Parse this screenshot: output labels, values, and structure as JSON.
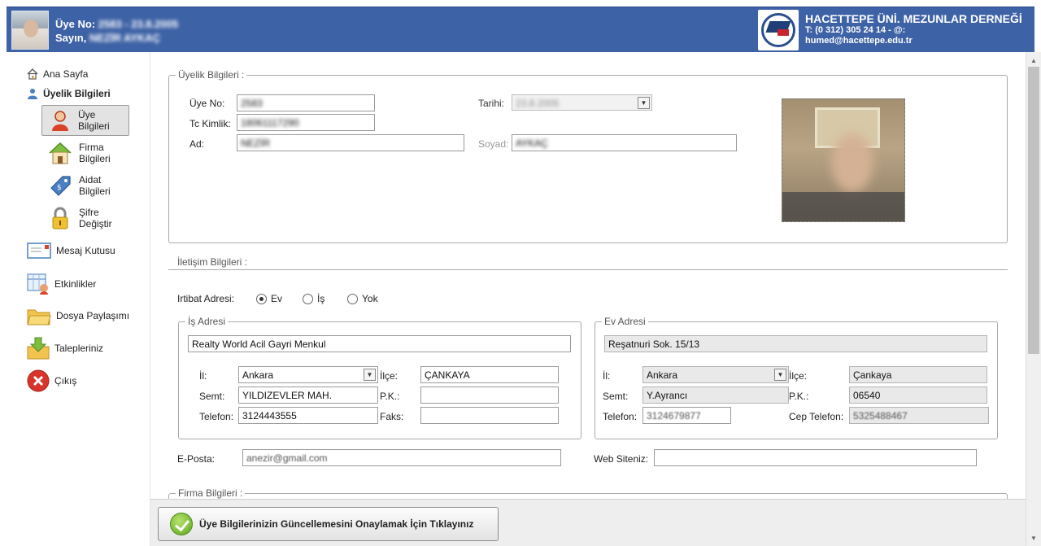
{
  "header": {
    "member_no_label": "Üye No:",
    "member_no_value": "2583 - 23.8.2005",
    "greeting_label": "Sayın,",
    "greeting_name": "NEZİR AYKAÇ",
    "org_title": "HACETTEPE ÜNİ. MEZUNLAR DERNEĞİ",
    "org_phone": "T: (0 312) 305 24 14 - @:",
    "org_email": "humed@hacettepe.edu.tr"
  },
  "sidebar": {
    "home": "Ana Sayfa",
    "membership": "Üyelik Bilgileri",
    "sub_items": [
      "Üye Bilgileri",
      "Firma Bilgileri",
      "Aidat Bilgileri",
      "Şifre Değiştir"
    ],
    "items": [
      "Mesaj Kutusu",
      "Etkinlikler",
      "Dosya Paylaşımı",
      "Talepleriniz",
      "Çıkış"
    ]
  },
  "membership": {
    "legend": "Üyelik Bilgileri :",
    "member_no_label": "Üye No:",
    "member_no_value": "2583",
    "tc_label": "Tc Kimlik:",
    "tc_value": "18061117290",
    "name_label": "Ad:",
    "name_value": "NEZİR",
    "date_label": "Tarihi:",
    "date_value": "23.8.2005",
    "surname_label": "Soyad:",
    "surname_value": "AYKAÇ"
  },
  "contact": {
    "title": "İletişim Bilgileri :",
    "address_label": "Irtibat Adresi:",
    "radio_options": [
      "Ev",
      "İş",
      "Yok"
    ],
    "selected_radio": "Ev",
    "work": {
      "legend": "İş Adresi",
      "address": "Realty World Acil Gayri Menkul",
      "il_label": "İl:",
      "il_value": "Ankara",
      "ilce_label": "İlçe:",
      "ilce_value": "ÇANKAYA",
      "semt_label": "Semt:",
      "semt_value": "YILDIZEVLER MAH.",
      "pk_label": "P.K.:",
      "pk_value": "",
      "phone_label": "Telefon:",
      "phone_value": "3124443555",
      "fax_label": "Faks:",
      "fax_value": ""
    },
    "home": {
      "legend": "Ev Adresi",
      "address": "Reşatnuri Sok. 15/13",
      "il_label": "İl:",
      "il_value": "Ankara",
      "ilce_label": "İlçe:",
      "ilce_value": "Çankaya",
      "semt_label": "Semt:",
      "semt_value": "Y.Ayrancı",
      "pk_label": "P.K.:",
      "pk_value": "06540",
      "phone_label": "Telefon:",
      "phone_value": "3124679877",
      "mobile_label": "Cep Telefon:",
      "mobile_value": "5325488467"
    },
    "email_label": "E-Posta:",
    "email_value": "anezir@gmail.com",
    "web_label": "Web Siteniz:",
    "web_value": ""
  },
  "company": {
    "legend": "Firma Bilgileri :"
  },
  "footer": {
    "confirm_label": "Üye Bilgilerinizin Güncellemesini Onaylamak İçin Tıklayınız"
  }
}
